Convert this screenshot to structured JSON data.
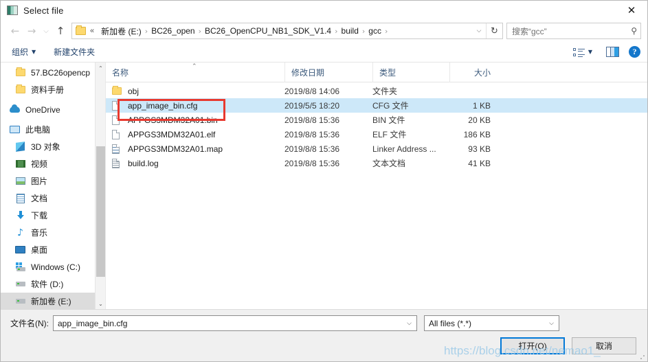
{
  "window": {
    "title": "Select file",
    "title_icon": "window-icon",
    "close_label": "✕"
  },
  "address_bar": {
    "back_icon": "←",
    "forward_icon": "→",
    "recent_icon": "⌵",
    "up_icon": "↑",
    "folder_icon": "folder-icon",
    "separator": "›",
    "double_arrow": "«",
    "crumbs": [
      "新加卷 (E:)",
      "BC26_open",
      "BC26_OpenCPU_NB1_SDK_V1.4",
      "build",
      "gcc"
    ],
    "dropdown_caret": "⌵",
    "refresh_icon": "↻",
    "search_value": "搜索“gcc”",
    "search_icon": "⚲"
  },
  "toolbar": {
    "organize_label": "组织",
    "organize_caret": "▼",
    "new_folder_label": "新建文件夹",
    "view_icon": "view-options-icon",
    "view_caret": "▼",
    "preview_pane_icon": "preview-pane-icon",
    "help_label": "?"
  },
  "nav_pane": {
    "items": [
      {
        "label": "57.BC26opencp",
        "icon": "folder-icon",
        "indent": true,
        "selected": false
      },
      {
        "label": "资料手册",
        "icon": "folder-icon",
        "indent": true,
        "selected": false
      },
      {
        "label": "OneDrive",
        "icon": "cloud-icon",
        "indent": false,
        "selected": false
      },
      {
        "label": "此电脑",
        "icon": "computer-icon",
        "indent": false,
        "selected": false
      },
      {
        "label": "3D 对象",
        "icon": "3d-objects-icon",
        "indent": true,
        "selected": false
      },
      {
        "label": "视频",
        "icon": "videos-icon",
        "indent": true,
        "selected": false
      },
      {
        "label": "图片",
        "icon": "pictures-icon",
        "indent": true,
        "selected": false
      },
      {
        "label": "文档",
        "icon": "documents-icon",
        "indent": true,
        "selected": false
      },
      {
        "label": "下载",
        "icon": "downloads-icon",
        "indent": true,
        "selected": false
      },
      {
        "label": "音乐",
        "icon": "music-icon",
        "indent": true,
        "selected": false
      },
      {
        "label": "桌面",
        "icon": "desktop-icon",
        "indent": true,
        "selected": false
      },
      {
        "label": "Windows (C:)",
        "icon": "windows-drive-icon",
        "indent": true,
        "selected": false
      },
      {
        "label": "软件 (D:)",
        "icon": "drive-icon",
        "indent": true,
        "selected": false
      },
      {
        "label": "新加卷 (E:)",
        "icon": "drive-icon",
        "indent": true,
        "selected": true
      }
    ],
    "scroll_up_icon": "⌃",
    "scroll_down_icon": "⌄"
  },
  "file_list": {
    "columns": {
      "name": "名称",
      "date_modified": "修改日期",
      "type": "类型",
      "size": "大小"
    },
    "sort_indicator": "⌃",
    "rows": [
      {
        "name": "obj",
        "date": "2019/8/8 14:06",
        "type": "文件夹",
        "size": "",
        "icon": "folder-icon",
        "selected": false
      },
      {
        "name": "app_image_bin.cfg",
        "date": "2019/5/5 18:20",
        "type": "CFG 文件",
        "size": "1 KB",
        "icon": "file-icon",
        "selected": true
      },
      {
        "name": "APPGS3MDM32A01.bin",
        "date": "2019/8/8 15:36",
        "type": "BIN 文件",
        "size": "20 KB",
        "icon": "file-icon",
        "selected": false
      },
      {
        "name": "APPGS3MDM32A01.elf",
        "date": "2019/8/8 15:36",
        "type": "ELF 文件",
        "size": "186 KB",
        "icon": "file-icon",
        "selected": false
      },
      {
        "name": "APPGS3MDM32A01.map",
        "date": "2019/8/8 15:36",
        "type": "Linker Address ...",
        "size": "93 KB",
        "icon": "file-lines-icon",
        "selected": false
      },
      {
        "name": "build.log",
        "date": "2019/8/8 15:36",
        "type": "文本文档",
        "size": "41 KB",
        "icon": "file-text-icon",
        "selected": false
      }
    ],
    "annotation_color": "#e8392f"
  },
  "footer": {
    "filename_label": "文件名(N):",
    "filename_value": "app_image_bin.cfg",
    "filename_caret": "⌵",
    "filter_value": "All files (*.*)",
    "filter_caret": "⌵",
    "open_label": "打开(O)",
    "cancel_label": "取消"
  },
  "overlay": {
    "watermark": "https://blog.csdn.net/nemao1_"
  }
}
